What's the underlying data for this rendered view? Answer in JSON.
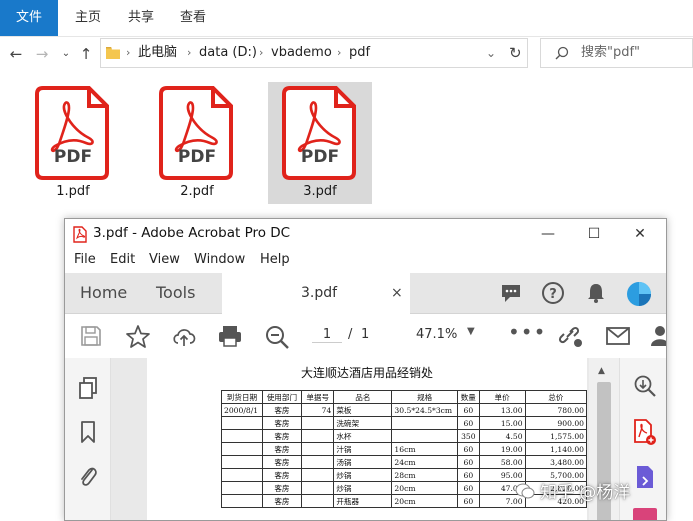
{
  "ribbon": {
    "tabs": [
      "文件",
      "主页",
      "共享",
      "查看"
    ]
  },
  "address": {
    "crumbs": [
      "此电脑",
      "data (D:)",
      "vbademo",
      "pdf"
    ]
  },
  "search": {
    "placeholder": "搜索\"pdf\""
  },
  "files": [
    {
      "name": "1.pdf",
      "icon_label": "PDF",
      "selected": false
    },
    {
      "name": "2.pdf",
      "icon_label": "PDF",
      "selected": false
    },
    {
      "name": "3.pdf",
      "icon_label": "PDF",
      "selected": true
    }
  ],
  "acrobat": {
    "title": "3.pdf - Adobe Acrobat Pro DC",
    "menu": [
      "File",
      "Edit",
      "View",
      "Window",
      "Help"
    ],
    "tabs": {
      "home": "Home",
      "tools": "Tools",
      "doc": "3.pdf",
      "close": "×"
    },
    "toolbar": {
      "page_current": "1",
      "page_sep": "/",
      "page_total": "1",
      "zoom": "47.1%"
    }
  },
  "document": {
    "title": "大连顺达酒店用品经销处",
    "headers": [
      "到货日期",
      "使用部门",
      "单据号",
      "品名",
      "规格",
      "数量",
      "单价",
      "总价"
    ],
    "rows": [
      [
        "2000/8/1",
        "客房",
        "74",
        "菜板",
        "30.5*24.5*3cm",
        "60",
        "13.00",
        "780.00"
      ],
      [
        "",
        "客房",
        "",
        "洗碗架",
        "",
        "60",
        "15.00",
        "900.00"
      ],
      [
        "",
        "客房",
        "",
        "水杯",
        "",
        "350",
        "4.50",
        "1,575.00"
      ],
      [
        "",
        "客房",
        "",
        "汁锅",
        "16cm",
        "60",
        "19.00",
        "1,140.00"
      ],
      [
        "",
        "客房",
        "",
        "汤锅",
        "24cm",
        "60",
        "58.00",
        "3,480.00"
      ],
      [
        "",
        "客房",
        "",
        "炒锅",
        "28cm",
        "60",
        "95.00",
        "5,700.00"
      ],
      [
        "",
        "客房",
        "",
        "炒锅",
        "20cm",
        "60",
        "47.00",
        "2,820.00"
      ],
      [
        "",
        "客房",
        "",
        "开瓶器",
        "20cm",
        "60",
        "7.00",
        "420.00"
      ]
    ]
  },
  "watermark": "知乎 @杨洋",
  "colors": {
    "ribbon_active": "#1979ca",
    "pdf_red": "#e0231b",
    "selection": "#d9d9d9"
  }
}
